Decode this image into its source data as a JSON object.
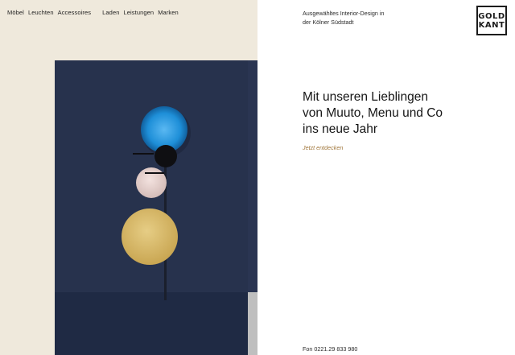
{
  "nav": {
    "main": [
      "Möbel",
      "Leuchten",
      "Accessoires"
    ],
    "secondary": [
      "Laden",
      "Leistungen",
      "Marken"
    ]
  },
  "brand": {
    "logo_line1": "GOLD",
    "logo_line2": "KANT",
    "tagline_line1": "Ausgewähltes Interior-Design in",
    "tagline_line2": "der Kölner Südstadt"
  },
  "hero": {
    "headline_line1": "Mit unseren Lieblingen",
    "headline_line2": "von Muuto, Menu und Co",
    "headline_line3": "ins neue Jahr",
    "cta": "Jetzt entdecken"
  },
  "footer": {
    "phone": "Fon 0221.29 833 980"
  },
  "colors": {
    "beige_panel": "#efe9dc",
    "navy_wall": "#27324d",
    "accent_gold": "#a0763a",
    "lamp_blue": "#1e8fd8",
    "lamp_gold": "#d9bb6a"
  }
}
